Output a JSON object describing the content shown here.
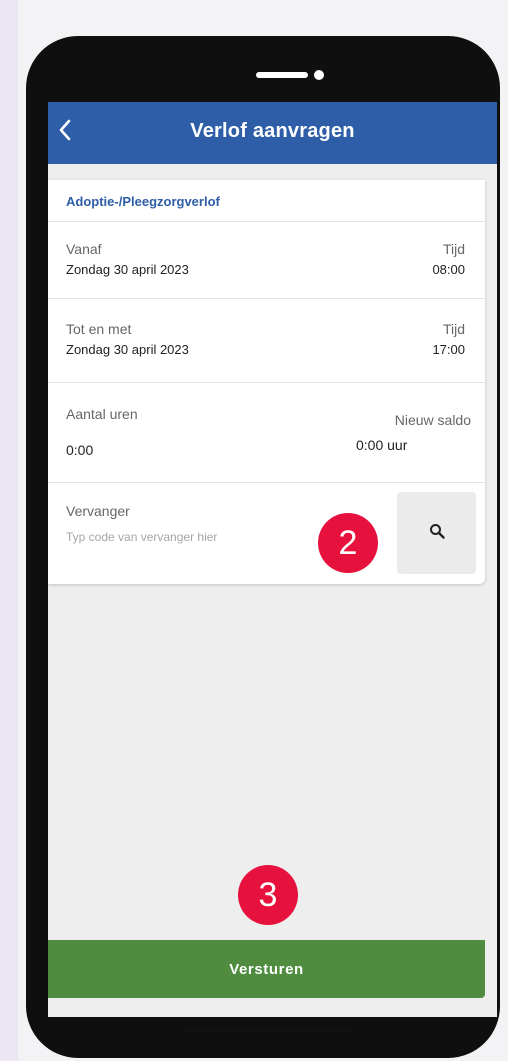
{
  "header": {
    "title": "Verlof aanvragen",
    "back_icon": "chevron-left-icon",
    "bg_color": "#2f5ea8"
  },
  "form": {
    "leave_type": "Adoptie-/Pleegzorgverlof",
    "from": {
      "label": "Vanaf",
      "date": "Zondag 30 april 2023",
      "time_label": "Tijd",
      "time": "08:00"
    },
    "until": {
      "label": "Tot en met",
      "date": "Zondag 30 april 2023",
      "time_label": "Tijd",
      "time": "17:00"
    },
    "hours": {
      "label": "Aantal uren",
      "value": "0:00"
    },
    "new_balance": {
      "label": "Nieuw saldo",
      "value": "0:00 uur"
    },
    "substitute": {
      "label": "Vervanger",
      "placeholder": "Typ code van vervanger hier",
      "search_icon": "search-icon"
    }
  },
  "annotations": {
    "step2": "2",
    "step3": "3",
    "color": "#e6123d"
  },
  "submit": {
    "label": "Versturen",
    "color": "#4f8c3f"
  }
}
